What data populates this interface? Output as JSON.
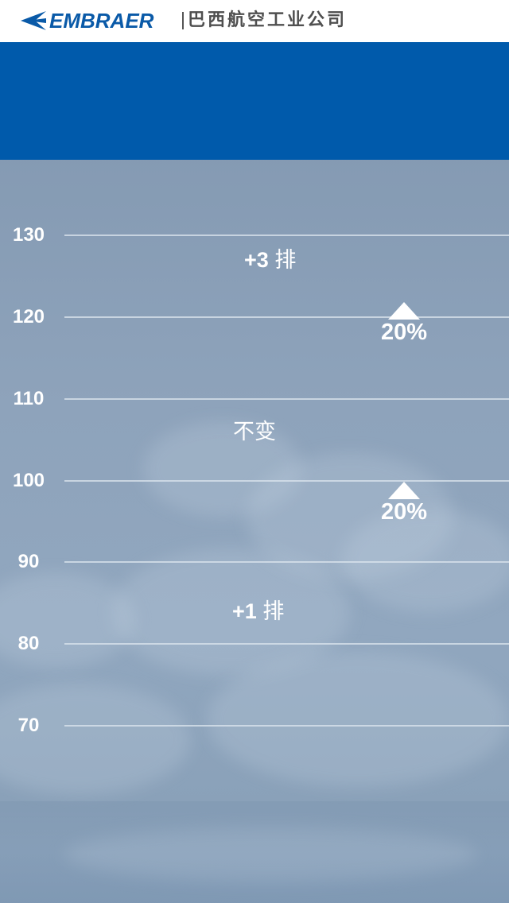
{
  "header": {
    "brand_name": "EMBRAER",
    "brand_cn": "巴西航空工业公司",
    "logo_icon": "embraer-arrow-logo",
    "brand_color": "#0a5aa8",
    "band_color": "#005aab"
  },
  "chart_data": {
    "type": "annotated-scale",
    "y_ticks": [
      "130",
      "120",
      "110",
      "100",
      "90",
      "80",
      "70"
    ],
    "ylim": [
      70,
      130
    ],
    "grid": true,
    "annotations": [
      {
        "prefix": "+3",
        "suffix": "排",
        "y": 127
      },
      {
        "prefix": "",
        "suffix": "不变",
        "y": 106
      },
      {
        "prefix": "+1",
        "suffix": "排",
        "y": 84
      }
    ],
    "markers": [
      {
        "label": "20%",
        "icon": "triangle-up-icon",
        "y": 120
      },
      {
        "label": "20%",
        "icon": "triangle-up-icon",
        "y": 98
      }
    ]
  }
}
